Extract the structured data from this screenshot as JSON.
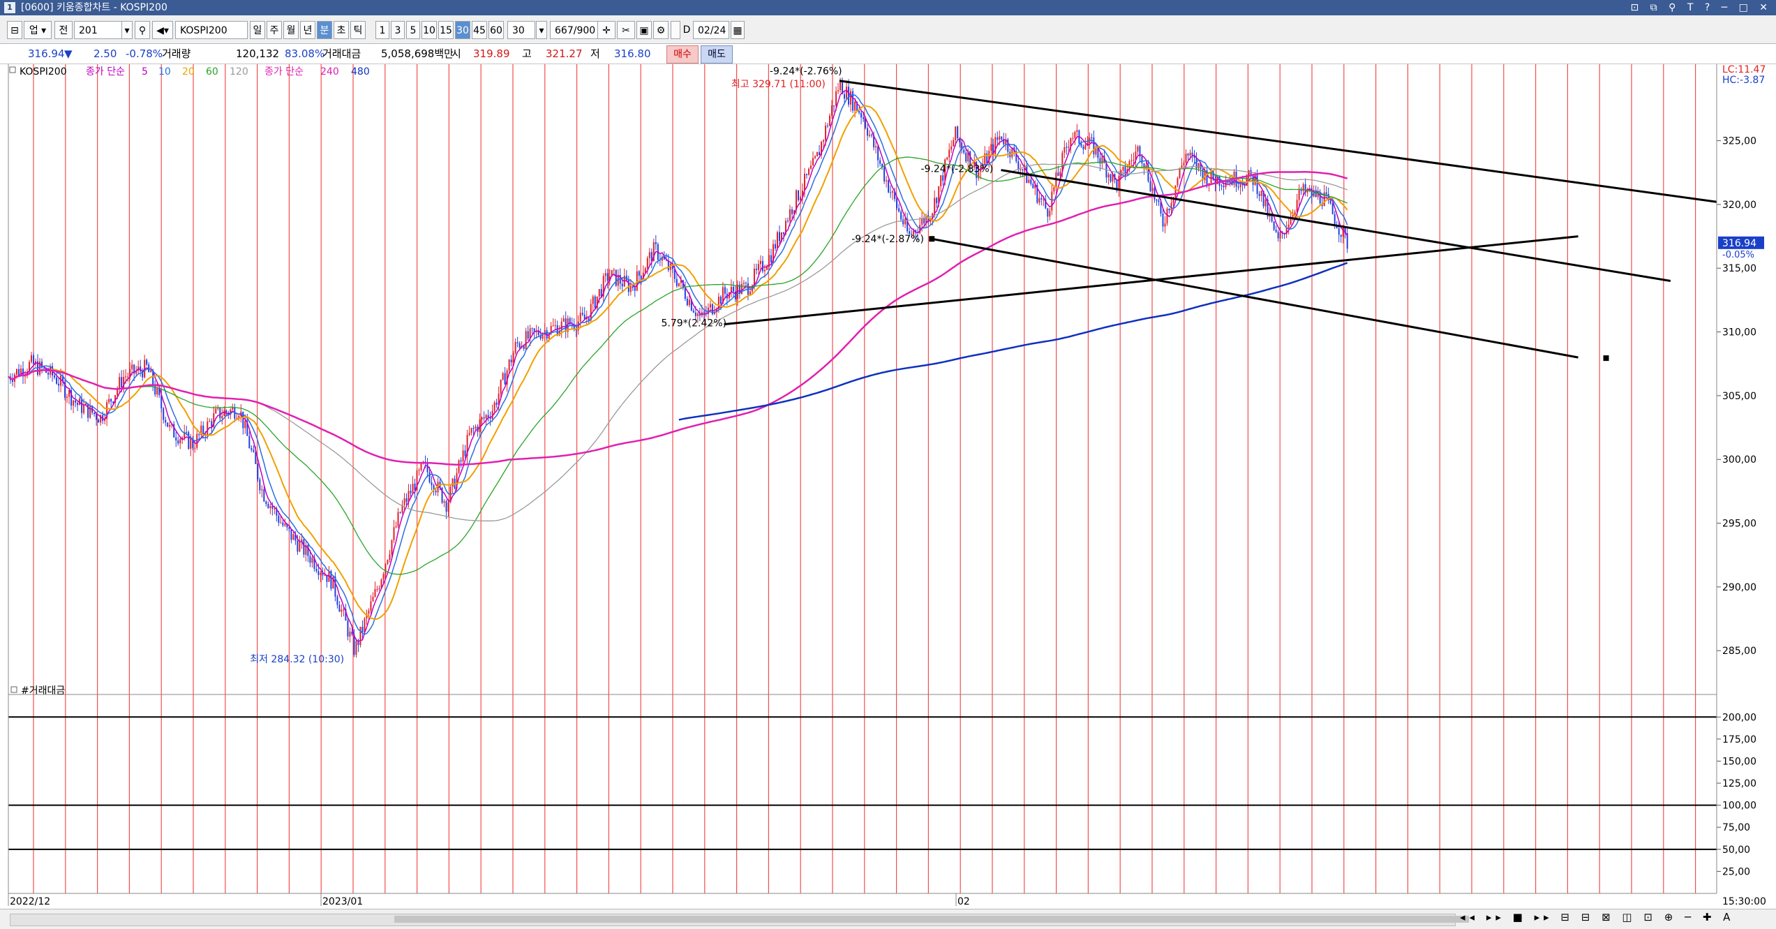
{
  "window": {
    "icon_text": "1",
    "title": "[0600] 키움종합차트 - KOSPI200",
    "controls": "⊡ ⧉ ⚲ T ? ─ □ ✕"
  },
  "toolbar": {
    "market": "업",
    "type": "전",
    "code": "201",
    "symbol": "KOSPI200",
    "periods": [
      "일",
      "주",
      "월",
      "년",
      "분",
      "초",
      "틱"
    ],
    "active_period": "분",
    "intervals": [
      "1",
      "3",
      "5",
      "10",
      "15",
      "30",
      "45",
      "60"
    ],
    "active_interval": "30",
    "interval_value": "30",
    "count": "667/900",
    "date_label": "D",
    "date": "02/24"
  },
  "quote": {
    "price": "316.94",
    "change_arrow": "▼",
    "change": "2.50",
    "change_pct": "-0.78%",
    "volume_label": "거래량",
    "volume": "120,132",
    "volume_pct": "83.08%",
    "amount_label": "거래대금",
    "amount": "5,058,698백만",
    "open_label": "시",
    "open": "319.89",
    "high_label": "고",
    "high": "321.27",
    "low_label": "저",
    "low": "316.80",
    "buy_label": "매수",
    "sell_label": "매도"
  },
  "legend": {
    "symbol": "KOSPI200",
    "ma_label_1": "종가 단순",
    "ma_periods_1": [
      "5",
      "10",
      "20",
      "60",
      "120"
    ],
    "ma_label_2": "종가 단순",
    "ma_periods_2": [
      "240",
      "480"
    ]
  },
  "colors": {
    "ma5": "#c000c0",
    "ma10": "#2a6ee0",
    "ma20": "#f0a000",
    "ma60": "#29a329",
    "ma120": "#9a9a9a",
    "ma240": "#e020b0",
    "ma480": "#1030c0",
    "candle_up": "#e0202a",
    "candle_down": "#2040e0",
    "vline": "#f03030"
  },
  "price_axis": {
    "ticks": [
      "325,00",
      "320,00",
      "315,00",
      "310,00",
      "305,00",
      "300,00",
      "295,00",
      "290,00",
      "285,00"
    ],
    "lc": "LC:11.47",
    "hc": "HC:-3.87",
    "current": "316.94",
    "current_change": "-0.05%"
  },
  "volume_axis": {
    "title": "#거래대금",
    "ticks": [
      "200,00",
      "175,00",
      "150,00",
      "125,00",
      "100,00",
      "75,00",
      "50,00",
      "25,00"
    ]
  },
  "time_axis": {
    "labels": [
      "2022/12",
      "2023/01",
      "02"
    ],
    "time": "15:30:00"
  },
  "annotations": {
    "high": "최고 329.71 (11:00)",
    "low": "최저 284.32 (10:30)",
    "fib_top": "-9.24*(-2.76%)",
    "fib_mid": "-9.24*(-2.83%)",
    "fib_low": "-9.24*(-2.87%)",
    "fib_base": "5.79*(2.42%)"
  },
  "chart_data": {
    "type": "candlestick",
    "title": "KOSPI200",
    "interval": "30분",
    "ylim": [
      282,
      331
    ],
    "x_ticks": [
      "2022/12",
      "2023/01",
      "02"
    ],
    "price_path": [
      [
        0,
        306.5
      ],
      [
        1,
        307.5
      ],
      [
        2,
        306.5
      ],
      [
        3,
        304.3
      ],
      [
        4,
        303.3
      ],
      [
        5,
        306.5
      ],
      [
        6,
        307.2
      ],
      [
        7,
        302.3
      ],
      [
        8,
        301.2
      ],
      [
        9,
        303.5
      ],
      [
        10,
        304.0
      ],
      [
        11,
        297.5
      ],
      [
        12,
        294.5
      ],
      [
        13,
        292.5
      ],
      [
        14,
        290.5
      ],
      [
        15,
        285.0
      ],
      [
        16,
        290.0
      ],
      [
        17,
        296.0
      ],
      [
        18,
        299.5
      ],
      [
        19,
        296.5
      ],
      [
        20,
        302.0
      ],
      [
        21,
        304.0
      ],
      [
        22,
        309.0
      ],
      [
        23,
        310.0
      ],
      [
        24,
        310.5
      ],
      [
        25,
        311.0
      ],
      [
        26,
        314.5
      ],
      [
        27,
        313.5
      ],
      [
        28,
        316.5
      ],
      [
        29,
        314.0
      ],
      [
        30,
        311.0
      ],
      [
        31,
        313.0
      ],
      [
        32,
        313.5
      ],
      [
        33,
        316.0
      ],
      [
        34,
        320.0
      ],
      [
        35,
        323.5
      ],
      [
        36,
        329.5
      ],
      [
        37,
        327.0
      ],
      [
        38,
        322.0
      ],
      [
        39,
        317.5
      ],
      [
        40,
        319.5
      ],
      [
        41,
        325.5
      ],
      [
        42,
        322.5
      ],
      [
        43,
        325.5
      ],
      [
        44,
        322.5
      ],
      [
        45,
        319.5
      ],
      [
        46,
        325.5
      ],
      [
        47,
        324.5
      ],
      [
        48,
        321.5
      ],
      [
        49,
        324.5
      ],
      [
        50,
        318.5
      ],
      [
        51,
        324.0
      ],
      [
        52,
        322.0
      ],
      [
        53,
        322.0
      ],
      [
        54,
        322.0
      ],
      [
        55,
        317.0
      ],
      [
        56,
        321.0
      ],
      [
        57,
        320.5
      ],
      [
        58,
        317.0
      ]
    ],
    "series": [
      {
        "name": "5"
      },
      {
        "name": "10"
      },
      {
        "name": "20"
      },
      {
        "name": "60"
      },
      {
        "name": "120"
      },
      {
        "name": "240"
      },
      {
        "name": "480"
      }
    ],
    "volume_ylim": [
      0,
      220
    ],
    "volume_gridlines": [
      200,
      100,
      50
    ],
    "trendlines": [
      {
        "from": [
          36,
          329.7
        ],
        "to": [
          74,
          320.2
        ]
      },
      {
        "from": [
          43,
          322.7
        ],
        "to": [
          72,
          314.0
        ]
      },
      {
        "from": [
          40,
          317.3
        ],
        "to": [
          68,
          308.0
        ]
      },
      {
        "from": [
          31,
          310.6
        ],
        "to": [
          68,
          317.5
        ]
      }
    ]
  }
}
